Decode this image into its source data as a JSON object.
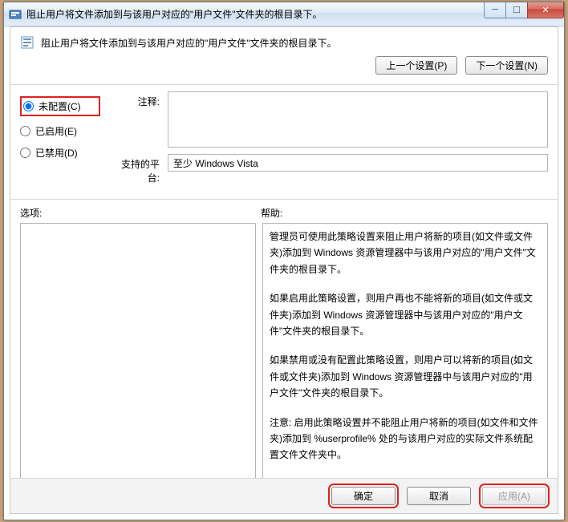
{
  "window": {
    "title": "阻止用户将文件添加到与该用户对应的\"用户文件\"文件夹的根目录下。"
  },
  "header": {
    "title": "阻止用户将文件添加到与该用户对应的\"用户文件\"文件夹的根目录下。"
  },
  "nav": {
    "prev": "上一个设置(P)",
    "next": "下一个设置(N)"
  },
  "radios": {
    "not_configured": "未配置(C)",
    "enabled": "已启用(E)",
    "disabled": "已禁用(D)",
    "selected": "not_configured"
  },
  "fields": {
    "comment_label": "注释:",
    "comment_value": "",
    "platform_label": "支持的平台:",
    "platform_value": "至少 Windows Vista"
  },
  "sections": {
    "options_label": "选项:",
    "help_label": "帮助:"
  },
  "help": {
    "p1": "管理员可使用此策略设置来阻止用户将新的项目(如文件或文件夹)添加到 Windows 资源管理器中与该用户对应的\"用户文件\"文件夹的根目录下。",
    "p2": "如果启用此策略设置，则用户再也不能将新的项目(如文件或文件夹)添加到 Windows 资源管理器中与该用户对应的\"用户文件\"文件夹的根目录下。",
    "p3": "如果禁用或没有配置此策略设置，则用户可以将新的项目(如文件或文件夹)添加到 Windows 资源管理器中与该用户对应的\"用户文件\"文件夹的根目录下。",
    "p4": "注意: 启用此策略设置并不能阻止用户将新的项目(如文件和文件夹)添加到 %userprofile% 处的与该用户对应的实际文件系统配置文件文件夹中。"
  },
  "footer": {
    "ok": "确定",
    "cancel": "取消",
    "apply": "应用(A)"
  }
}
